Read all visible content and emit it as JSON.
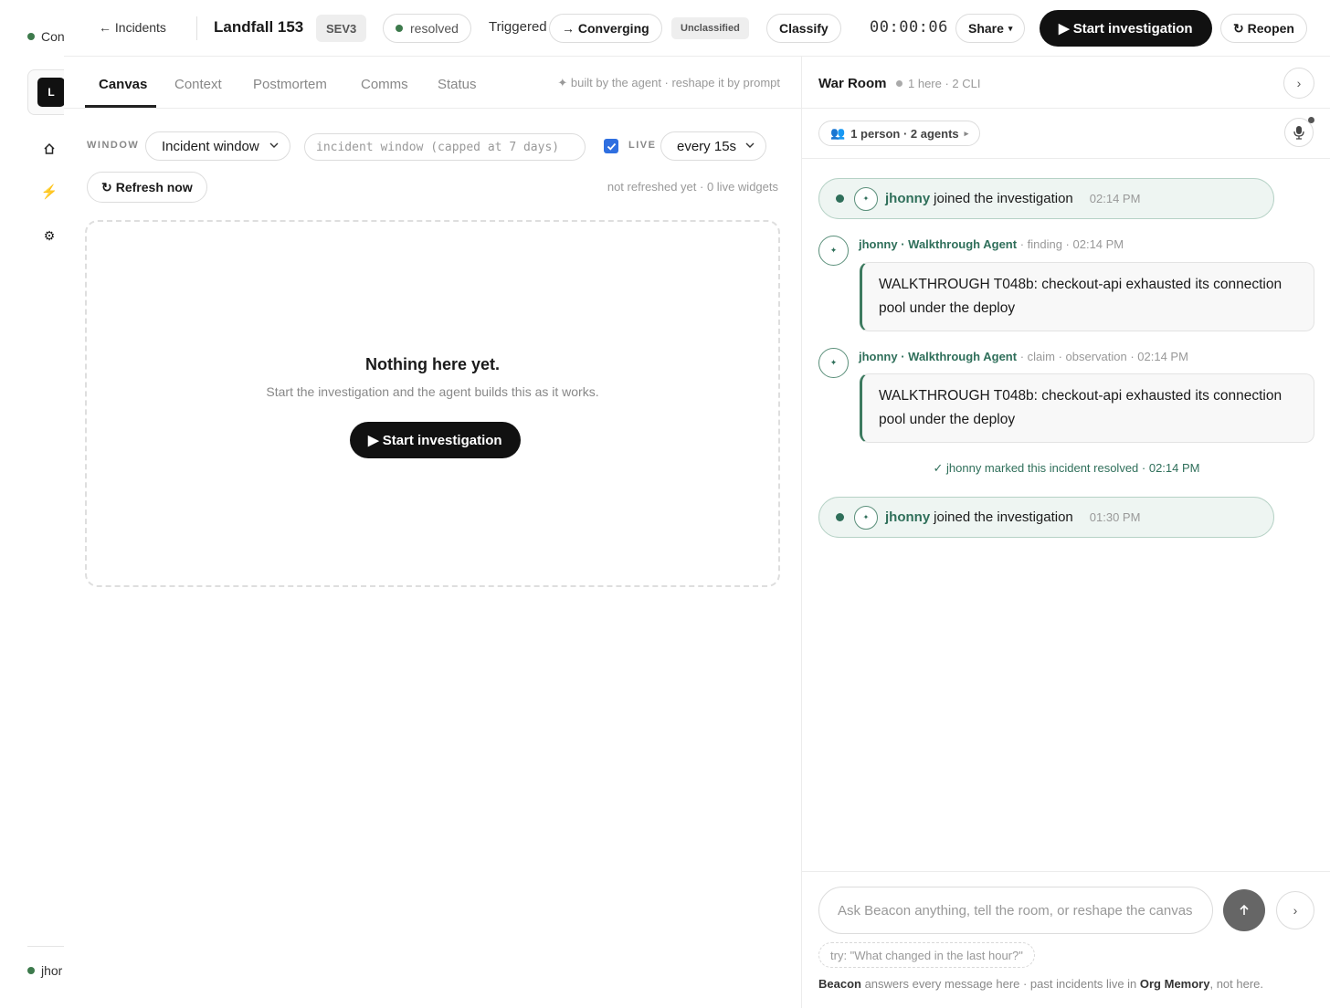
{
  "rail": {
    "top_label": "Con",
    "logo_letter": "L",
    "user_label": "jhor",
    "icons": [
      "home-icon",
      "bolt-icon",
      "gear-icon"
    ]
  },
  "topbar": {
    "back_label": "← Incidents",
    "incident_title": "Landfall 153",
    "severity": "SEV3",
    "status": "resolved",
    "triggered_label": "Triggered",
    "converging_label": "→ Converging",
    "unclassified_label": "Unclassified",
    "classify_label": "Classify",
    "timer": "00:00:06",
    "share_label": "Share",
    "share_caret": "▾",
    "start_label": "▶ Start investigation",
    "reopen_label": "↻ Reopen"
  },
  "main": {
    "tabs": [
      {
        "label": "Canvas",
        "active": true
      },
      {
        "label": "Context",
        "active": false
      },
      {
        "label": "Postmortem",
        "active": false
      },
      {
        "label": "Comms",
        "active": false
      },
      {
        "label": "Status",
        "active": false
      }
    ],
    "tabs_note": "✦ built by the agent · reshape it by prompt",
    "window_label": "WINDOW",
    "window_value": "Incident window",
    "window_placeholder": "incident window (capped at 7 days)",
    "live_checked": true,
    "live_label": "LIVE",
    "interval_value": "every 15s",
    "refresh_label": "Refresh now",
    "refresh_note": "not refreshed yet · 0 live widgets",
    "empty_title": "Nothing here yet.",
    "empty_sub": "Start the investigation and the agent builds this as it works.",
    "empty_button": "▶ Start investigation"
  },
  "war_room": {
    "title": "War Room",
    "meta": "1 here · 2 CLI",
    "people_label": "1 person · 2 agents",
    "people_caret": "▸",
    "events": [
      {
        "user": "jhonny",
        "text": "joined the investigation",
        "time": "02:14 PM"
      },
      {
        "author": "jhonny · Walkthrough Agent",
        "meta": " · finding · 02:14 PM",
        "body": "WALKTHROUGH T048b: checkout-api exhausted its connection pool under the deploy"
      },
      {
        "author": "jhonny · Walkthrough Agent",
        "meta": " · claim · observation · 02:14 PM",
        "body": "WALKTHROUGH T048b: checkout-api exhausted its connection pool under the deploy"
      },
      {
        "note": "✓ jhonny marked this incident resolved · 02:14 PM"
      },
      {
        "user": "jhonny",
        "text": "joined the investigation",
        "time": "01:30 PM"
      }
    ],
    "compose_placeholder": "Ask Beacon anything, tell the room, or reshape the canvas",
    "hint": "try: \"What changed in the last hour?\"",
    "footer": {
      "beacon": "Beacon",
      "middle": " answers every message here · past incidents live in ",
      "org": "Org Memory",
      "end": ", not here."
    }
  },
  "colors": {
    "accent_green": "#2f6f5a",
    "primary_button": "#111111",
    "checkbox_blue": "#2f6fe0"
  }
}
